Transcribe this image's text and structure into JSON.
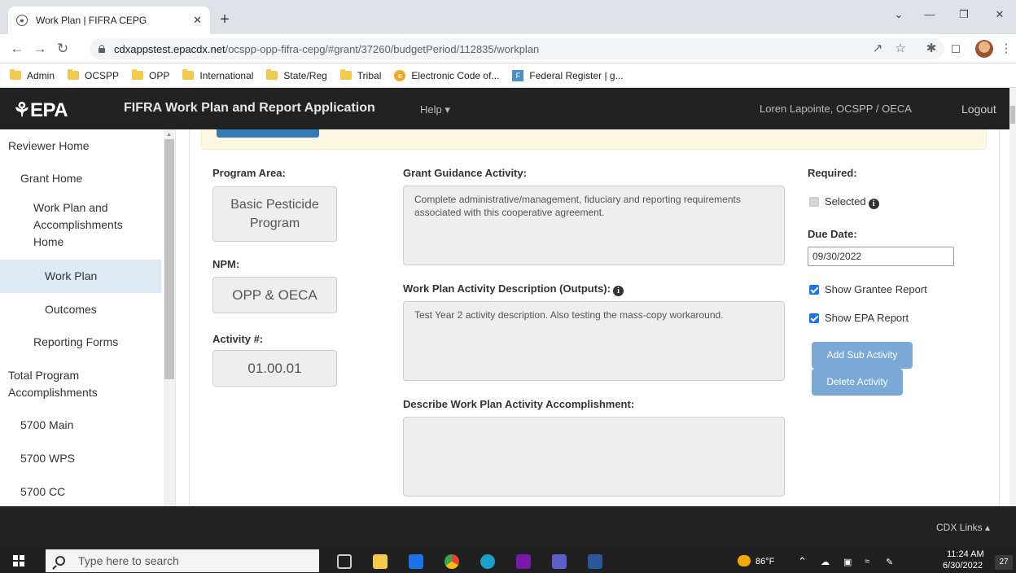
{
  "browser": {
    "tab_title": "Work Plan | FIFRA CEPG",
    "new_tab": "+",
    "url_host": "cdxappstest.epacdx.net",
    "url_path": "/ocspp-opp-fifra-cepg/#grant/37260/budgetPeriod/112835/workplan",
    "bookmarks": [
      "Admin",
      "OCSPP",
      "OPP",
      "International",
      "State/Reg",
      "Tribal",
      "Electronic Code of...",
      "Federal Register | g..."
    ]
  },
  "header": {
    "logo": "⚘EPA",
    "title": "FIFRA Work Plan and Report Application",
    "help": "Help ▾",
    "user": "Loren Lapointe,   OCSPP / OECA",
    "logout": "Logout"
  },
  "sidebar": {
    "items": [
      {
        "label": "Reviewer Home"
      },
      {
        "label": "Grant Home"
      },
      {
        "label": "Work Plan and Accomplishments Home"
      },
      {
        "label": "Work Plan"
      },
      {
        "label": "Outcomes"
      },
      {
        "label": "Reporting Forms"
      },
      {
        "label": "Total Program Accomplishments"
      },
      {
        "label": "5700 Main"
      },
      {
        "label": "5700 WPS"
      },
      {
        "label": "5700 CC"
      }
    ]
  },
  "form": {
    "program_area_label": "Program Area:",
    "program_area_value": "Basic Pesticide Program",
    "npm_label": "NPM:",
    "npm_value": "OPP & OECA",
    "activity_label": "Activity #:",
    "activity_value": "01.00.01",
    "guidance_label": "Grant Guidance Activity:",
    "guidance_value": "Complete administrative/management, fiduciary and reporting requirements associated with this cooperative agreement.",
    "description_label": "Work Plan Activity Description (Outputs):",
    "description_value": "Test Year 2 activity description.  Also testing the mass-copy workaround.",
    "accomplishment_label": "Describe Work Plan Activity Accomplishment:",
    "accomplishment_value": "",
    "required_label": "Required:",
    "selected_label": "Selected",
    "due_date_label": "Due Date:",
    "due_date_value": "09/30/2022",
    "show_grantee_label": "Show Grantee Report",
    "show_epa_label": "Show EPA Report",
    "add_sub_activity": "Add Sub Activity",
    "delete_activity": "Delete Activity"
  },
  "footer": {
    "cdx_links": "CDX Links ▴"
  },
  "taskbar": {
    "search_placeholder": "Type here to search",
    "temperature": "86°F",
    "time": "11:24 AM",
    "date": "6/30/2022",
    "notifications": "27"
  }
}
